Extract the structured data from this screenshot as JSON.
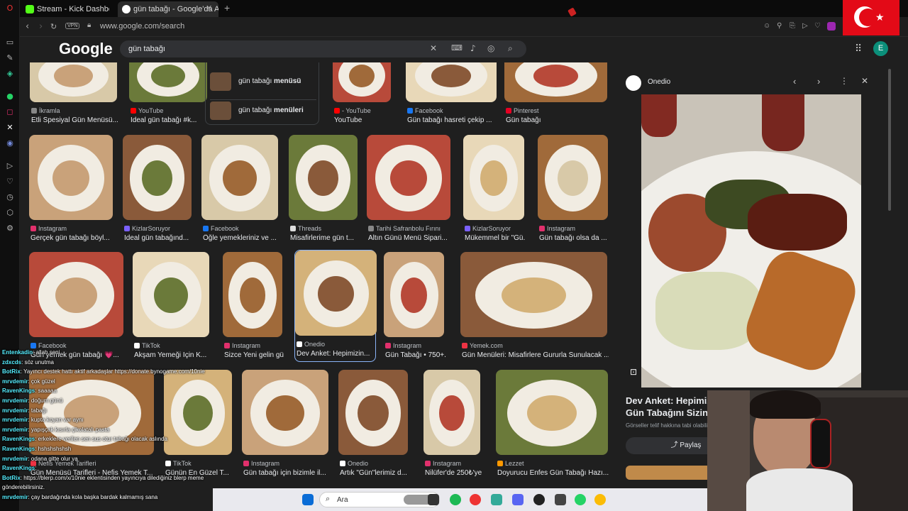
{
  "tabs": [
    {
      "label": "Stream - Kick Dashboard",
      "color": "#53fc18"
    },
    {
      "label": "gün tabağı - Google'da Ar...",
      "color": "#4285f4"
    }
  ],
  "address": {
    "url": "www.google.com/search",
    "vpn": "VPN"
  },
  "google": {
    "logo": "Google",
    "query": "gün tabağı",
    "avatar": "E"
  },
  "top_row": [
    {
      "source": "İkramla",
      "title": "Etli Spesiyal Gün Menüsü...",
      "src_color": "#888"
    },
    {
      "source": "YouTube",
      "title": "İdeal gün tabağı #k...",
      "src_color": "#f00"
    },
    {
      "source": "- YouTube",
      "title": "YouTube",
      "src_color": "#f00"
    },
    {
      "source": "Facebook",
      "title": "Gün tabağı hasreti çekip ...",
      "src_color": "#1877f2"
    },
    {
      "source": "Pinterest",
      "title": "Gün tabağı",
      "src_color": "#e60023"
    }
  ],
  "related": [
    {
      "label": "gün tabağı ",
      "bold": "menüsü"
    },
    {
      "label": "gün tabağı ",
      "bold": "menüleri"
    }
  ],
  "row2": [
    {
      "source": "Instagram",
      "title": "Gerçek gün tabağı böyl...",
      "src_color": "#e1306c"
    },
    {
      "source": "KizlarSoruyor",
      "title": "İdeal gün tabağınd...",
      "src_color": "#7b61ff"
    },
    {
      "source": "Facebook",
      "title": "Öğle yemekleriniz ve ...",
      "src_color": "#1877f2"
    },
    {
      "source": "Threads",
      "title": "Misafirlerime gün t...",
      "src_color": "#ddd"
    },
    {
      "source": "Tarihi Safranbolu Fırını",
      "title": "Altın Günü Menü Sipari...",
      "src_color": "#888"
    },
    {
      "source": "KizlarSoruyor",
      "title": "Mükemmel bir \"Gü...",
      "src_color": "#7b61ff"
    },
    {
      "source": "Instagram",
      "title": "Gün tabağı olsa da ...",
      "src_color": "#e1306c"
    }
  ],
  "row3": [
    {
      "source": "Facebook",
      "title": "Gün yemek gün tabağı 💗...",
      "src_color": "#1877f2"
    },
    {
      "source": "TikTok",
      "title": "Akşam Yemeği İçin K...",
      "src_color": "#fff"
    },
    {
      "source": "Instagram",
      "title": "Sizce Yeni gelin gü...",
      "src_color": "#e1306c"
    },
    {
      "source": "Onedio",
      "title": "Dev Anket: Hepimizin...",
      "src_color": "#fff"
    },
    {
      "source": "Instagram",
      "title": "Gün Tabağı • 750+...",
      "src_color": "#e1306c"
    },
    {
      "source": "Yemek.com",
      "title": "Gün Menüleri: Misafirlere Gururla Sunulacak ...",
      "src_color": "#e34"
    }
  ],
  "row4": [
    {
      "source": "Nefis Yemek Tarifleri",
      "title": "Gün Menüsü Tarifleri - Nefis Yemek T...",
      "src_color": "#e34"
    },
    {
      "source": "TikTok",
      "title": "Günün En Güzel T...",
      "src_color": "#fff"
    },
    {
      "source": "Instagram",
      "title": "Gün tabağı için bizimle il...",
      "src_color": "#e1306c"
    },
    {
      "source": "Onedio",
      "title": "Artık \"Gün\"lerimiz d...",
      "src_color": "#fff"
    },
    {
      "source": "Instagram",
      "title": "Nilüfer'de 250₺'ye ...",
      "src_color": "#e1306c"
    },
    {
      "source": "Lezzet",
      "title": "Doyurucu Enfes Gün Tabağı Hazı...",
      "src_color": "#f90"
    }
  ],
  "preview": {
    "source": "Onedio",
    "title_line1": "Dev Anket: Hepimizin",
    "title_line2": "Gün Tabağını Sizin Oy",
    "note": "Görseller telif hakkına tabi olabili",
    "share": "Paylaş"
  },
  "taskbar": {
    "search": "Ara"
  },
  "chat": [
    {
      "user": "Entenkadin",
      "msg": ": allah seni"
    },
    {
      "user": "zdxcds",
      "msg": ": söz unutma"
    },
    {
      "user": "BotRix",
      "msg": ": Yayıncı destek hattı aktif arkadaşlar https://donate.bynogame.com/10nie"
    },
    {
      "user": "mrvdemir",
      "msg": ": çok güzel"
    },
    {
      "user": "RavenKings",
      "msg": ": saaaaa"
    },
    {
      "user": "mrvdemir",
      "msg": ": doğum günü"
    },
    {
      "user": "mrvdemir",
      "msg": ": tabağı"
    },
    {
      "user": "mrvdemir",
      "msg": ": kupta koyan var aynı"
    },
    {
      "user": "mrvdemir",
      "msg": ": yapışçak kısırla çikolatalı pasta"
    },
    {
      "user": "RavenKings",
      "msg": ": erkeklere verilen sen sus otur tabağı olacak aslında"
    },
    {
      "user": "RavenKings",
      "msg": ": hshshshshsh"
    },
    {
      "user": "mrvdemir",
      "msg": ": odana gitte olur ya"
    },
    {
      "user": "RavenKings",
      "msg": ": "
    },
    {
      "user": "BotRix",
      "msg": ": https://blerp.com/x/10nie eklentisinden yayıncıya dilediğiniz blerp meme"
    },
    {
      "user": "",
      "msg": "gönderebilirsiniz."
    },
    {
      "user": "mrvdemir",
      "msg": ": çay bardağında kola başka bardak kalmamış sana"
    }
  ]
}
